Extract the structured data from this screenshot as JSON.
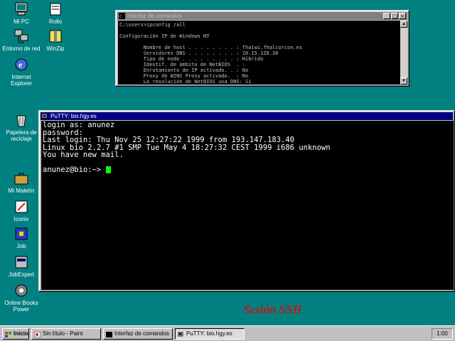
{
  "desktop": {
    "icons": [
      {
        "label": "Mi PC",
        "icon": "my-computer-icon"
      },
      {
        "label": "Entorno de red",
        "icon": "network-neighborhood-icon"
      },
      {
        "label": "Internet Explorer",
        "icon": "internet-explorer-icon"
      },
      {
        "label": "Papelera de reciclaje",
        "icon": "recycle-bin-icon"
      },
      {
        "label": "Mi Maletín",
        "icon": "briefcase-icon"
      },
      {
        "label": "Iconix",
        "icon": "app-icon"
      },
      {
        "label": "Job",
        "icon": "app-icon"
      },
      {
        "label": "JobExpert",
        "icon": "app-icon"
      },
      {
        "label": "Online Books Power",
        "icon": "app-icon"
      },
      {
        "label": "Rollo",
        "icon": "app-icon"
      },
      {
        "label": "WinZip",
        "icon": "winzip-icon"
      }
    ]
  },
  "cmd_window": {
    "title": "Interfaz de comandos",
    "lines": [
      "C:\\users>ipconfig /all",
      "",
      "Configuración IP de Windows NT",
      "",
      "        Nombre de host . . . . . . . . : fhaiwi.fhalcorcon.es",
      "        Servidores DNS . . . . . . . . : 10.15.128.30",
      "        Tipo de nodo . . . . . . . . . : Híbrido",
      "        Identif. de ámbito de NetBIOS  . :",
      "        Enrutamiento de IP activado. . : No",
      "        Proxy de WINS Proxy activado.  : No",
      "        La resolución de NetBIOS usa DNS: Sí"
    ]
  },
  "putty_window": {
    "title": "PuTTY: bio.hgy.es",
    "lines": [
      "login as: anunez",
      "password:",
      "Last login: Thu Nov 25 12:27:22 1999 from 193.147.183.40",
      "Linux bio 2.2.7 #1 SMP Tue May 4 18:27:32 CEST 1999 i686 unknown",
      "You have new mail.",
      "",
      "anunez@bio:~> "
    ]
  },
  "caption": "Sesión SSH",
  "taskbar": {
    "start_label": "Inicio",
    "tasks": [
      {
        "label": "Sin título - Paint",
        "pressed": false
      },
      {
        "label": "Interfaz de comandos",
        "pressed": false
      },
      {
        "label": "PuTTY: bio.hgy.es",
        "pressed": true
      }
    ],
    "clock": "1:00"
  },
  "colors": {
    "desktop": "#008080",
    "title_active": "#000080",
    "terminal_text": "#ffffff",
    "cursor": "#00ff00",
    "caption": "#c81414"
  }
}
